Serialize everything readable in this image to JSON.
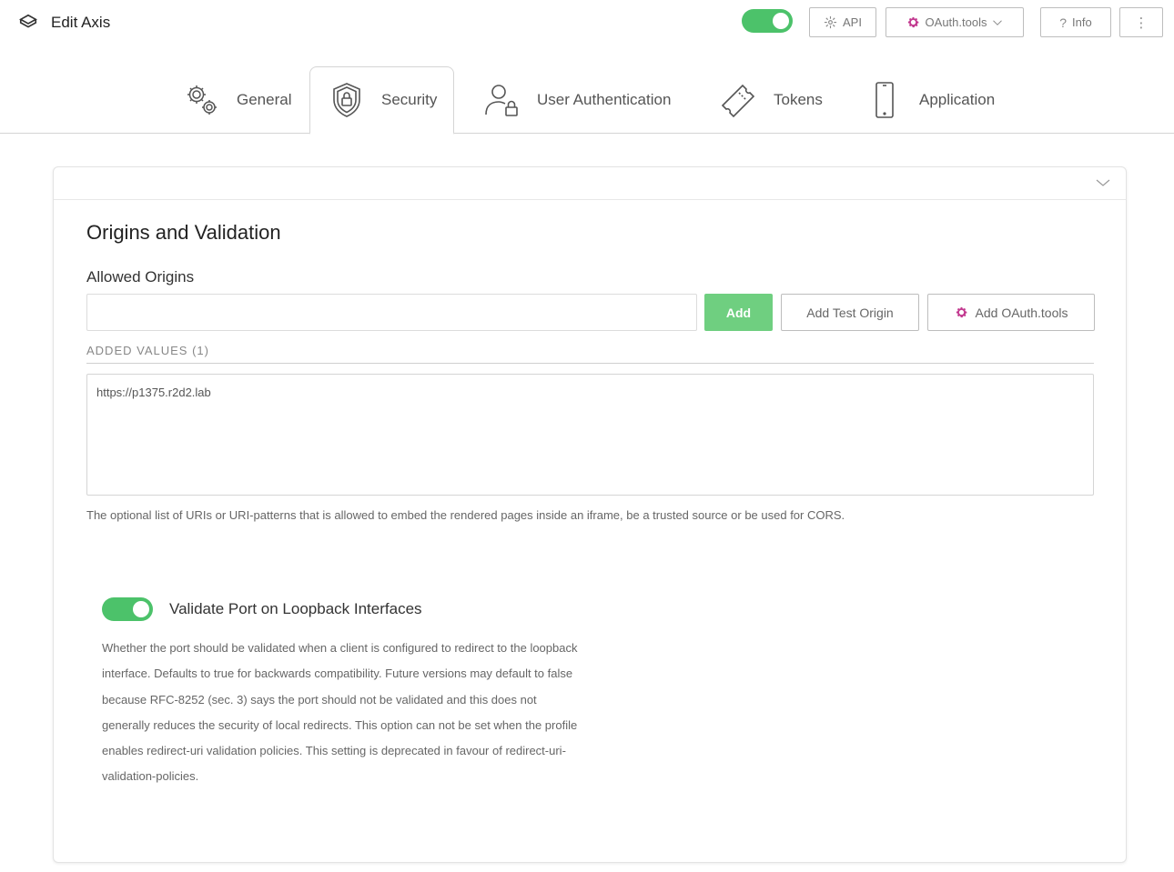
{
  "header": {
    "title": "Edit Axis",
    "toggle_on": true,
    "api_label": "API",
    "oauth_label": "OAuth.tools",
    "info_label": "Info",
    "more_label": "⋮"
  },
  "tabs": [
    {
      "label": "General",
      "icon": "gears-icon"
    },
    {
      "label": "Security",
      "icon": "shield-lock-icon",
      "active": true
    },
    {
      "label": "User Authentication",
      "icon": "user-lock-icon"
    },
    {
      "label": "Tokens",
      "icon": "ticket-icon"
    },
    {
      "label": "Application",
      "icon": "phone-icon"
    }
  ],
  "section": {
    "title": "Origins and Validation",
    "allowed_origins_label": "Allowed Origins",
    "origin_input_value": "",
    "add_label": "Add",
    "add_test_origin_label": "Add Test Origin",
    "add_oauth_tools_label": "Add OAuth.tools",
    "added_values_label": "ADDED VALUES (1)",
    "values": [
      "https://p1375.r2d2.lab"
    ],
    "help_text": "The optional list of URIs or URI-patterns that is allowed to embed the rendered pages inside an iframe, be a trusted source or be used for CORS."
  },
  "validate_port": {
    "enabled": true,
    "title": "Validate Port on Loopback Interfaces",
    "description": "Whether the port should be validated when a client is configured to redirect to the loopback interface. Defaults to true for backwards compatibility. Future versions may default to false because RFC-8252 (sec. 3) says the port should not be validated and this does not generally reduces the security of local redirects. This option can not be set when the profile enables redirect-uri validation policies. This setting is deprecated in favour of redirect-uri-validation-policies."
  },
  "colors": {
    "accent_green": "#4cc26a",
    "add_button_green": "#6fcf80",
    "oauth_pink": "#c2398f"
  }
}
